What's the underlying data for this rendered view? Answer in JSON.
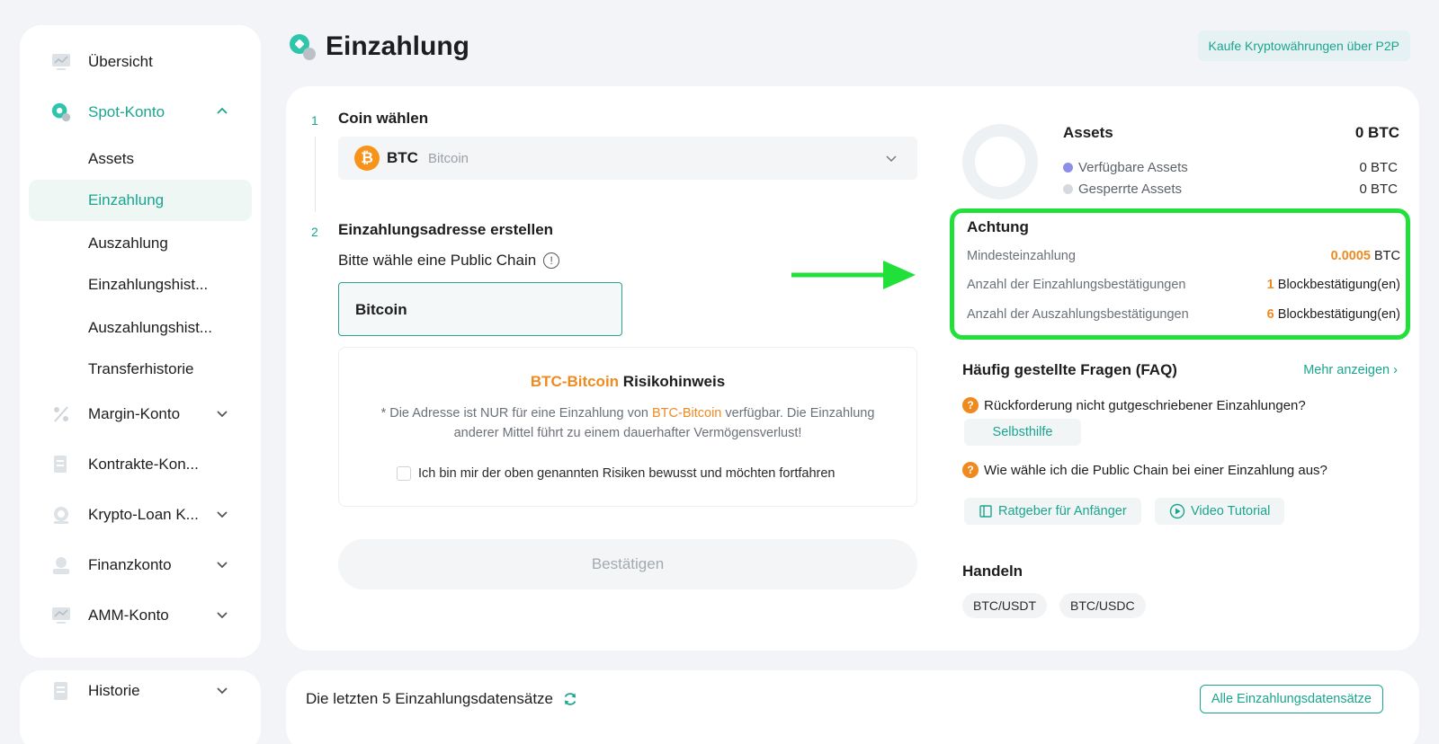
{
  "sidebar": {
    "items": [
      {
        "label": "Übersicht",
        "icon": "chart-icon"
      },
      {
        "label": "Spot-Konto",
        "icon": "spot-icon"
      },
      {
        "label": "Margin-Konto",
        "icon": "percent-icon"
      },
      {
        "label": "Kontrakte-Kon...",
        "icon": "contract-icon"
      },
      {
        "label": "Krypto-Loan K...",
        "icon": "loan-icon"
      },
      {
        "label": "Finanzkonto",
        "icon": "finance-icon"
      },
      {
        "label": "AMM-Konto",
        "icon": "amm-icon"
      }
    ],
    "sub_items": [
      "Assets",
      "Einzahlung",
      "Auszahlung",
      "Einzahlungshist...",
      "Auszahlungshist...",
      "Transferhistorie"
    ],
    "history": {
      "label": "Historie",
      "icon": "history-icon"
    }
  },
  "header": {
    "title": "Einzahlung",
    "p2p_link": "Kaufe Kryptowährungen über P2P"
  },
  "steps": {
    "step1": {
      "num": "1",
      "title": "Coin wählen"
    },
    "step2": {
      "num": "2",
      "title": "Einzahlungsadresse erstellen"
    }
  },
  "coin": {
    "symbol": "BTC",
    "name": "Bitcoin"
  },
  "chain": {
    "label": "Bitte wähle eine Public Chain",
    "selected": "Bitcoin"
  },
  "risk": {
    "highlight": "BTC-Bitcoin",
    "title_suffix": " Risikohinweis",
    "text_prefix": "* Die Adresse ist NUR für eine Einzahlung von ",
    "text_suffix": " verfügbar. Die Einzahlung anderer Mittel führt zu einem dauerhafter Vermögensverlust!",
    "checkbox_label": "Ich bin mir der oben genannten Risiken bewusst und möchten fortfahren"
  },
  "confirm_label": "Bestätigen",
  "assets": {
    "title": "Assets",
    "total": "0 BTC",
    "available_label": "Verfügbare Assets",
    "available_value": "0 BTC",
    "locked_label": "Gesperrte Assets",
    "locked_value": "0 BTC",
    "colors": {
      "available": "#8b8fe8",
      "locked": "#d6d9dd"
    }
  },
  "attention": {
    "title": "Achtung",
    "min_label": "Mindesteinzahlung",
    "min_amount": "0.0005",
    "min_unit": " BTC",
    "deposit_conf_label": "Anzahl der Einzahlungsbestätigungen",
    "deposit_conf_num": "1",
    "withdraw_conf_label": "Anzahl der Auszahlungsbestätigungen",
    "withdraw_conf_num": "6",
    "conf_unit": " Blockbestätigung(en)"
  },
  "faq": {
    "title": "Häufig gestellte Fragen (FAQ)",
    "more": "Mehr anzeigen",
    "q1": "Rückforderung nicht gutgeschriebener Einzahlungen?",
    "self_help": "Selbsthilfe",
    "q2": "Wie wähle ich die Public Chain bei einer Einzahlung aus?",
    "guide": "Ratgeber für Anfänger",
    "video": "Video Tutorial"
  },
  "trade": {
    "title": "Handeln",
    "pairs": [
      "BTC/USDT",
      "BTC/USDC"
    ]
  },
  "records": {
    "title": "Die letzten 5 Einzahlungsdatensätze",
    "all_button": "Alle Einzahlungsdatensätze"
  },
  "theme": {
    "accent": "#1aa58f",
    "highlight_border": "#22e03a",
    "warning": "#ee8a1f"
  }
}
